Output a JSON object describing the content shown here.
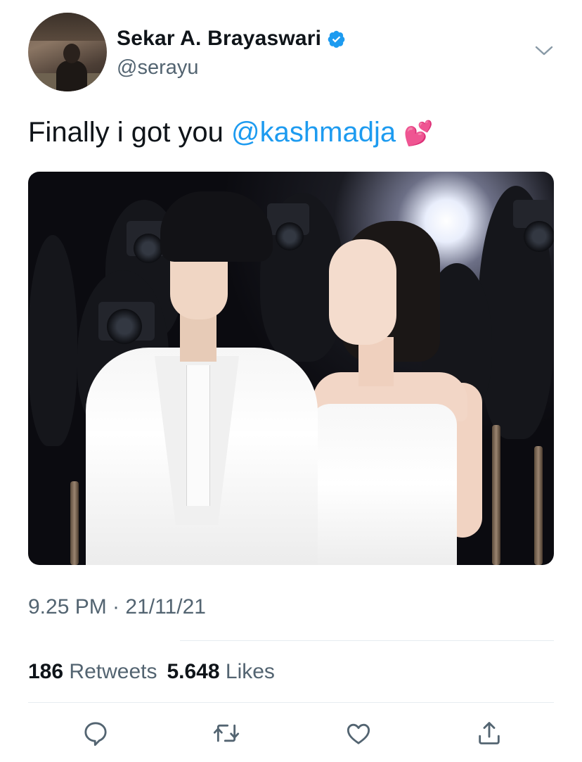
{
  "author": {
    "display_name": "Sekar A. Brayaswari",
    "handle": "@serayu",
    "verified": true
  },
  "tweet": {
    "text_prefix": "Finally i got you ",
    "mention": "@kashmadja",
    "emoji": "💕"
  },
  "meta": {
    "timestamp": "9.25 PM · 21/11/21"
  },
  "stats": {
    "retweets_count": "186",
    "retweets_label": "Retweets",
    "likes_count": "5.648",
    "likes_label": "Likes"
  },
  "actions": [
    "reply-icon",
    "retweet-icon",
    "like-icon",
    "share-icon"
  ],
  "colors": {
    "accent": "#1d9bf0",
    "text_primary": "#0f1419",
    "text_secondary": "#536471",
    "divider": "#e6ecf0"
  }
}
